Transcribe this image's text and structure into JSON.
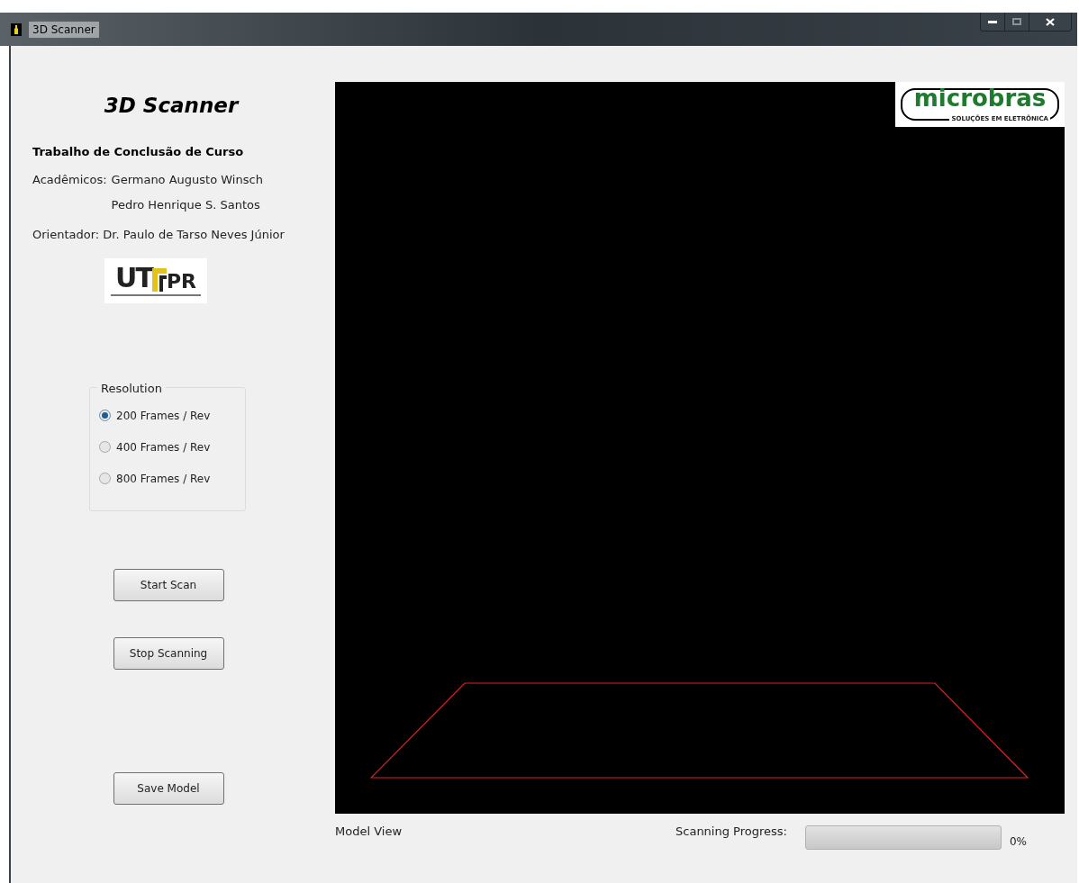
{
  "window": {
    "title": "3D Scanner"
  },
  "header": {
    "title": "3D Scanner",
    "subtitle": "Trabalho de Conclusão de Curso",
    "students_label": "Acadêmicos:",
    "students": [
      "Germano Augusto Winsch",
      "Pedro Henrique S. Santos"
    ],
    "advisor": "Orientador: Dr. Paulo de Tarso Neves Júnior"
  },
  "university_logo": {
    "text": "PR",
    "letters": "UT"
  },
  "resolution": {
    "title": "Resolution",
    "options": [
      {
        "label": "200 Frames / Rev",
        "selected": true
      },
      {
        "label": "400 Frames / Rev",
        "selected": false
      },
      {
        "label": "800 Frames / Rev",
        "selected": false
      }
    ]
  },
  "buttons": [
    "Start Scan",
    "Stop Scanning",
    "Save Model"
  ],
  "model_view": {
    "label": "Model View",
    "sponsor_logo": {
      "text": "microbras",
      "caption": "SOLUÇÕES EM ELETRÔNICA"
    }
  },
  "progress": {
    "label": "Scanning Progress:",
    "level": 0,
    "reading": "0%"
  }
}
